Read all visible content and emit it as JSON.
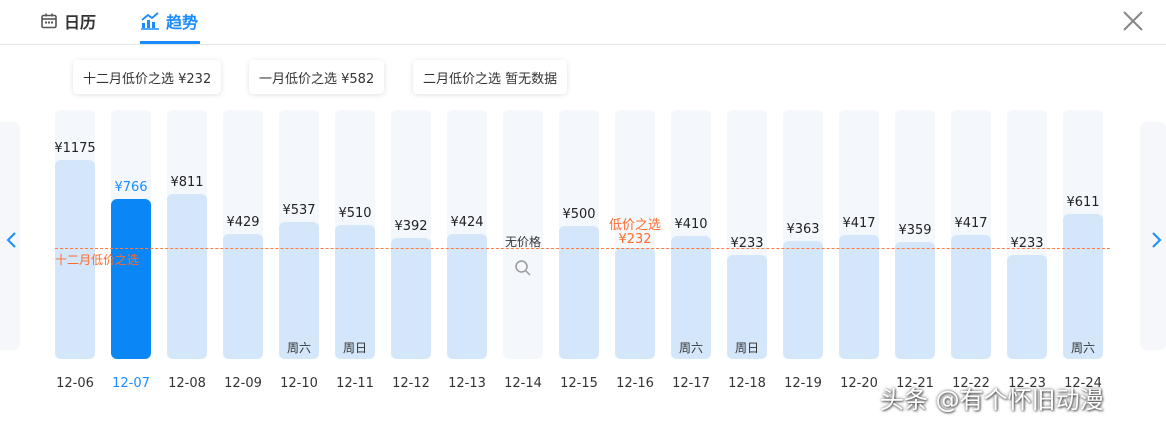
{
  "tabs": {
    "calendar_label": "日历",
    "trend_label": "趋势"
  },
  "summary": [
    {
      "text": "十二月低价之选 ¥232"
    },
    {
      "text": "一月低价之选 ¥582"
    },
    {
      "text": "二月低价之选 暂无数据"
    }
  ],
  "lowest_line_label": "十二月低价之选",
  "chart_data": {
    "type": "bar",
    "categories": [
      "12-06",
      "12-07",
      "12-08",
      "12-09",
      "12-10",
      "12-11",
      "12-12",
      "12-13",
      "12-14",
      "12-15",
      "12-16",
      "12-17",
      "12-18",
      "12-19",
      "12-20",
      "12-21",
      "12-22",
      "12-23",
      "12-24"
    ],
    "values": [
      1175,
      766,
      811,
      429,
      537,
      510,
      392,
      424,
      null,
      500,
      232,
      410,
      233,
      363,
      417,
      359,
      417,
      233,
      611
    ],
    "price_labels": [
      "¥1175",
      "¥766",
      "¥811",
      "¥429",
      "¥537",
      "¥510",
      "¥392",
      "¥424",
      "",
      "¥500",
      "¥232",
      "¥410",
      "¥233",
      "¥363",
      "¥417",
      "¥359",
      "¥417",
      "¥233",
      "¥611"
    ],
    "weekday_labels": [
      "",
      "",
      "",
      "",
      "周六",
      "周日",
      "",
      "",
      "",
      "",
      "",
      "周六",
      "周日",
      "",
      "",
      "",
      "",
      "",
      "周六"
    ],
    "selected_date": "12-07",
    "no_price_text": "无价格",
    "lowest_tag": "低价之选",
    "lowest_value": 232,
    "currency": "¥",
    "colors": {
      "bar": "#d3e6fa",
      "bar_selected": "#0a86f5",
      "accent": "#1a8cff",
      "lowest": "#ff6a2b"
    }
  },
  "watermark": "头条 @有个怀旧动漫"
}
